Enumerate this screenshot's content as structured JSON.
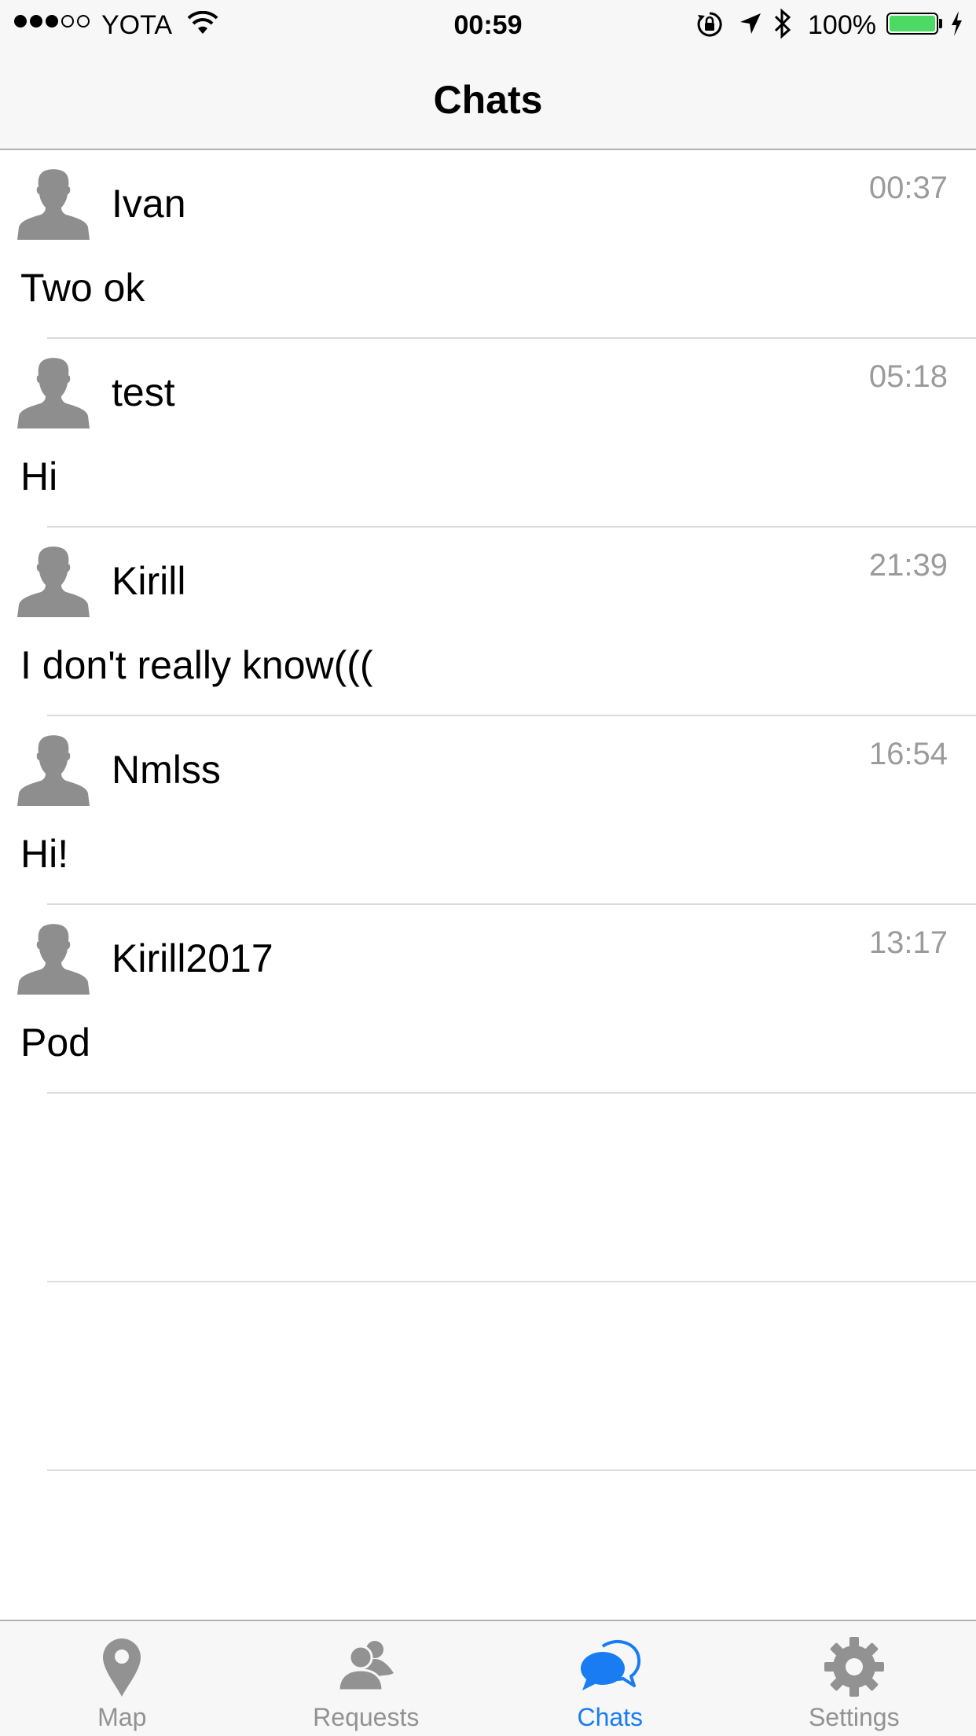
{
  "status_bar": {
    "carrier": "YOTA",
    "time": "00:59",
    "battery_percent": "100%",
    "signal_strength_bars": 3,
    "signal_total_bars": 5,
    "battery_level": 1.0,
    "battery_color": "#4cd964"
  },
  "nav": {
    "title": "Chats"
  },
  "chats": [
    {
      "name": "Ivan",
      "time": "00:37",
      "last_message": "Two ok"
    },
    {
      "name": "test",
      "time": "05:18",
      "last_message": "Hi"
    },
    {
      "name": "Kirill",
      "time": "21:39",
      "last_message": "I don't really know((("
    },
    {
      "name": "Nmlss",
      "time": "16:54",
      "last_message": "Hi!"
    },
    {
      "name": "Kirill2017",
      "time": "13:17",
      "last_message": "Pod"
    }
  ],
  "tabs": [
    {
      "label": "Map",
      "icon": "map-pin-icon",
      "active": false
    },
    {
      "label": "Requests",
      "icon": "requests-people-icon",
      "active": false
    },
    {
      "label": "Chats",
      "icon": "chat-bubbles-icon",
      "active": true
    },
    {
      "label": "Settings",
      "icon": "gear-icon",
      "active": false
    }
  ],
  "colors": {
    "accent": "#1a7cf2",
    "inactive_tab": "#929292",
    "timestamp": "#9b9b9b",
    "avatar": "#8e8e8e"
  }
}
